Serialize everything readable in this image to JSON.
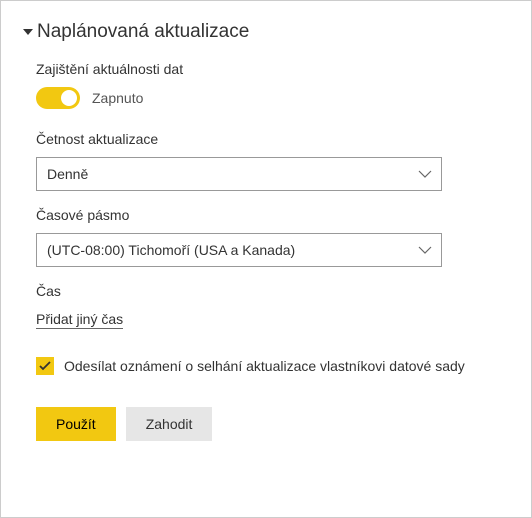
{
  "header": {
    "title": "Naplánovaná aktualizace"
  },
  "keepDataCurrent": {
    "label": "Zajištění aktuálnosti dat",
    "toggleState": "Zapnuto"
  },
  "frequency": {
    "label": "Četnost aktualizace",
    "value": "Denně"
  },
  "timezone": {
    "label": "Časové pásmo",
    "value": "(UTC-08:00) Tichomoří (USA a Kanada)"
  },
  "time": {
    "label": "Čas",
    "addLink": "Přidat jiný čas"
  },
  "notification": {
    "label": "Odesílat oznámení o selhání aktualizace vlastníkovi datové sady"
  },
  "buttons": {
    "apply": "Použít",
    "discard": "Zahodit"
  }
}
